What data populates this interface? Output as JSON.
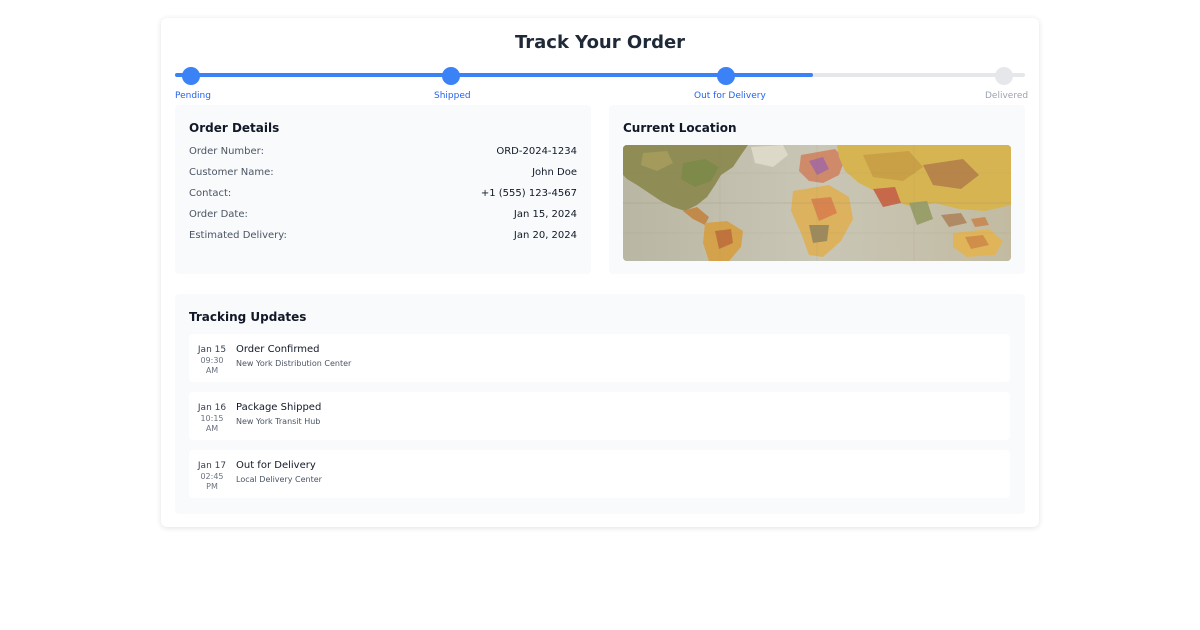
{
  "header": {
    "title": "Track Your Order"
  },
  "progress": {
    "completed_fraction": 0.75,
    "steps": [
      {
        "label": "Pending",
        "active": true
      },
      {
        "label": "Shipped",
        "active": true
      },
      {
        "label": "Out for Delivery",
        "active": true
      },
      {
        "label": "Delivered",
        "active": false
      }
    ]
  },
  "order_details": {
    "title": "Order Details",
    "rows": [
      {
        "label": "Order Number:",
        "value": "ORD-2024-1234"
      },
      {
        "label": "Customer Name:",
        "value": "John Doe"
      },
      {
        "label": "Contact:",
        "value": "+1 (555) 123-4567"
      },
      {
        "label": "Order Date:",
        "value": "Jan 15, 2024"
      },
      {
        "label": "Estimated Delivery:",
        "value": "Jan 20, 2024"
      }
    ]
  },
  "location": {
    "title": "Current Location",
    "image_icon": "world-map-image"
  },
  "tracking": {
    "title": "Tracking Updates",
    "updates": [
      {
        "date": "Jan 15",
        "time_line1": "09:30",
        "time_line2": "AM",
        "title": "Order Confirmed",
        "location": "New York Distribution Center"
      },
      {
        "date": "Jan 16",
        "time_line1": "10:15",
        "time_line2": "AM",
        "title": "Package Shipped",
        "location": "New York Transit Hub"
      },
      {
        "date": "Jan 17",
        "time_line1": "02:45",
        "time_line2": "PM",
        "title": "Out for Delivery",
        "location": "Local Delivery Center"
      }
    ]
  },
  "colors": {
    "accent": "#3b82f6",
    "accent_text": "#2563eb",
    "inactive": "#e5e7eb",
    "inactive_text": "#9ca3af",
    "panel_bg": "#f8fafc"
  }
}
